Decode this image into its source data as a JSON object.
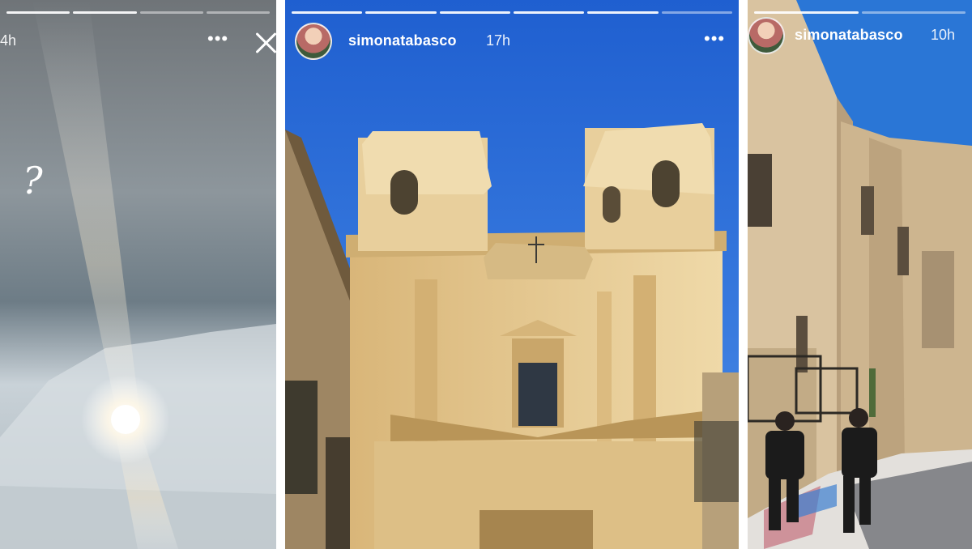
{
  "stories": [
    {
      "id": "left",
      "time": "4h",
      "more_label": "•••",
      "question_mark": "?",
      "progress": [
        true,
        true,
        false,
        false
      ]
    },
    {
      "id": "middle",
      "username": "simonatabasco",
      "time": "17h",
      "more_label": "•••",
      "progress": [
        true,
        true,
        true,
        true,
        true,
        false
      ]
    },
    {
      "id": "right",
      "username": "simonatabasco",
      "time": "10h",
      "progress": [
        true,
        false
      ]
    }
  ],
  "colors": {
    "sky_blue": "#2f71d8",
    "facade": "#e9cf9b",
    "text": "#ffffff"
  }
}
